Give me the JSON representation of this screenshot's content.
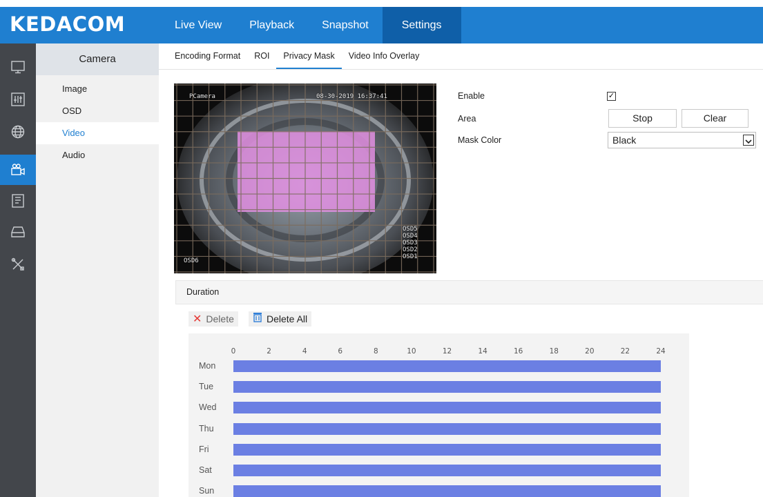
{
  "app": {
    "logo": "KEDACOM"
  },
  "topnav": [
    {
      "label": "Live View"
    },
    {
      "label": "Playback"
    },
    {
      "label": "Snapshot"
    },
    {
      "label": "Settings"
    }
  ],
  "iconbar": [
    {
      "icon": "monitor-icon"
    },
    {
      "icon": "sliders-icon"
    },
    {
      "icon": "globe-icon"
    },
    {
      "icon": "camera-icon"
    },
    {
      "icon": "document-icon"
    },
    {
      "icon": "storage-icon"
    },
    {
      "icon": "tools-icon"
    }
  ],
  "sidebar": {
    "title": "Camera",
    "items": [
      {
        "label": "Image"
      },
      {
        "label": "OSD"
      },
      {
        "label": "Video"
      },
      {
        "label": "Audio"
      }
    ]
  },
  "tabs": [
    {
      "label": "Encoding Format"
    },
    {
      "label": "ROI"
    },
    {
      "label": "Privacy Mask"
    },
    {
      "label": "Video Info Overlay"
    }
  ],
  "preview": {
    "osd_camera": "PCamera",
    "osd_datetime": "08-30-2019 16:37:41",
    "osd_labels": [
      "OSD5",
      "OSD4",
      "OSD3",
      "OSD2",
      "OSD1"
    ],
    "osd_left": "OSD6"
  },
  "form": {
    "enable_label": "Enable",
    "enable_checked": "✓",
    "area_label": "Area",
    "stop_label": "Stop",
    "clear_label": "Clear",
    "mask_color_label": "Mask Color",
    "mask_color_value": "Black"
  },
  "duration": {
    "title": "Duration",
    "delete_label": "Delete",
    "delete_all_label": "Delete All",
    "hours": [
      "0",
      "2",
      "4",
      "6",
      "8",
      "10",
      "12",
      "14",
      "16",
      "18",
      "20",
      "22",
      "24"
    ],
    "days": [
      {
        "label": "Mon",
        "start": 0,
        "end": 24
      },
      {
        "label": "Tue",
        "start": 0,
        "end": 24
      },
      {
        "label": "Wed",
        "start": 0,
        "end": 24
      },
      {
        "label": "Thu",
        "start": 0,
        "end": 24
      },
      {
        "label": "Fri",
        "start": 0,
        "end": 24
      },
      {
        "label": "Sat",
        "start": 0,
        "end": 24
      },
      {
        "label": "Sun",
        "start": 0,
        "end": 24
      }
    ]
  },
  "colors": {
    "brand_blue": "#1f7fd0",
    "mask_pink": "#d68ad6",
    "schedule_bar": "#6b7fe3"
  }
}
